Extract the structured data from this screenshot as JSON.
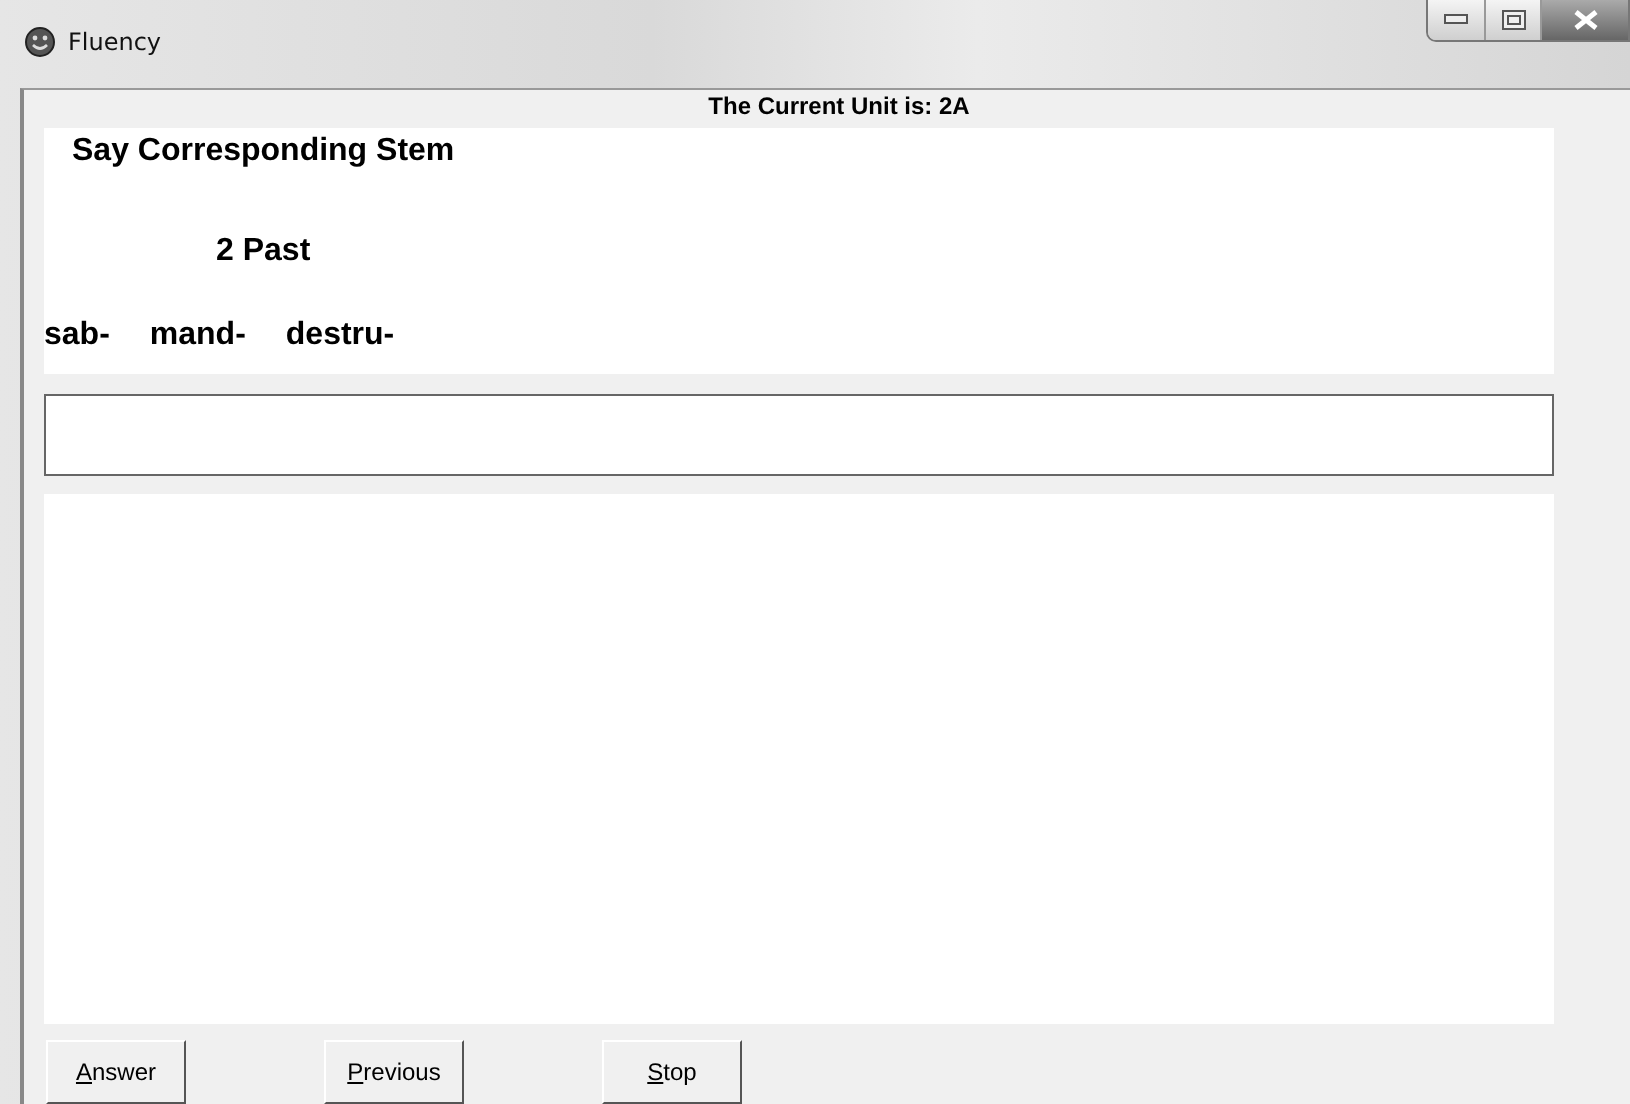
{
  "window": {
    "title": "Fluency"
  },
  "unit_label": "The Current Unit is: 2A",
  "prompt": {
    "instruction": "Say Corresponding Stem",
    "tense": "2 Past",
    "stems": [
      "sab-",
      "mand-",
      "destru-"
    ]
  },
  "buttons": [
    {
      "label": "Answer",
      "underline_first": true
    },
    {
      "label": "Previous",
      "underline_first": true
    },
    {
      "label": "Stop",
      "underline_first": true
    }
  ]
}
